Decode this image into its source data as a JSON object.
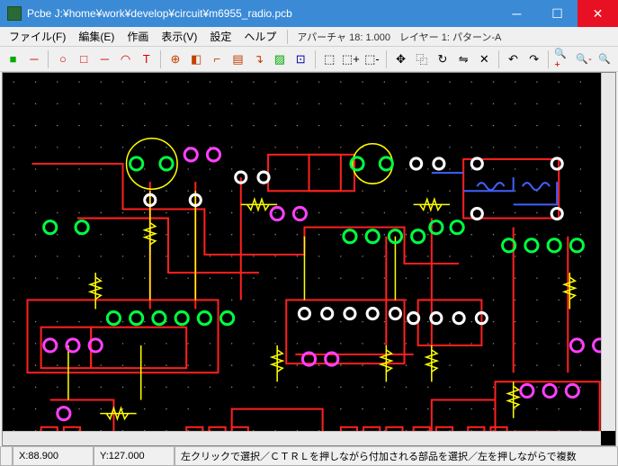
{
  "window": {
    "title": "Pcbe J:¥home¥work¥develop¥circuit¥m6955_radio.pcb"
  },
  "menu": {
    "file": "ファイル(F)",
    "edit": "編集(E)",
    "draw": "作画",
    "view": "表示(V)",
    "settings": "設定",
    "help": "ヘルプ",
    "aperture": "アパーチャ 18: 1.000",
    "layer": "レイヤー 1: パターン-A"
  },
  "toolbar_icons": {
    "layer_toggle": "■",
    "line_layer": "─",
    "circle": "○",
    "rect": "□",
    "line": "─",
    "arc": "◠",
    "text": "T",
    "pad": "⊕",
    "eraser": "◧",
    "polyline": "⌐",
    "fill": "▤",
    "route": "↴",
    "hatch": "▨",
    "flash": "⊡",
    "sel_rect": "⬚",
    "sel_add": "⬚+",
    "sel_sub": "⬚-",
    "move": "✥",
    "copy": "⿻",
    "rotate": "↻",
    "mirror": "⇋",
    "delete": "✕",
    "undo": "↶",
    "redo": "↷",
    "zoom_in": "🔍+",
    "zoom_out": "🔍-",
    "zoom_fit": "🔍"
  },
  "status": {
    "x_label": "X:",
    "x": "88.900",
    "y_label": "Y:",
    "y": "127.000",
    "hint": "左クリックで選択／ＣＴＲＬを押しながら付加される部品を選択／左を押しながらで複数"
  },
  "colors": {
    "title_bg": "#3a8ad6",
    "canvas_bg": "#000000",
    "red": "#ff2020",
    "yellow": "#ffff00",
    "green": "#00ff40",
    "magenta": "#ff40ff",
    "blue": "#4060ff",
    "white": "#ffffff",
    "grid": "#707070"
  }
}
